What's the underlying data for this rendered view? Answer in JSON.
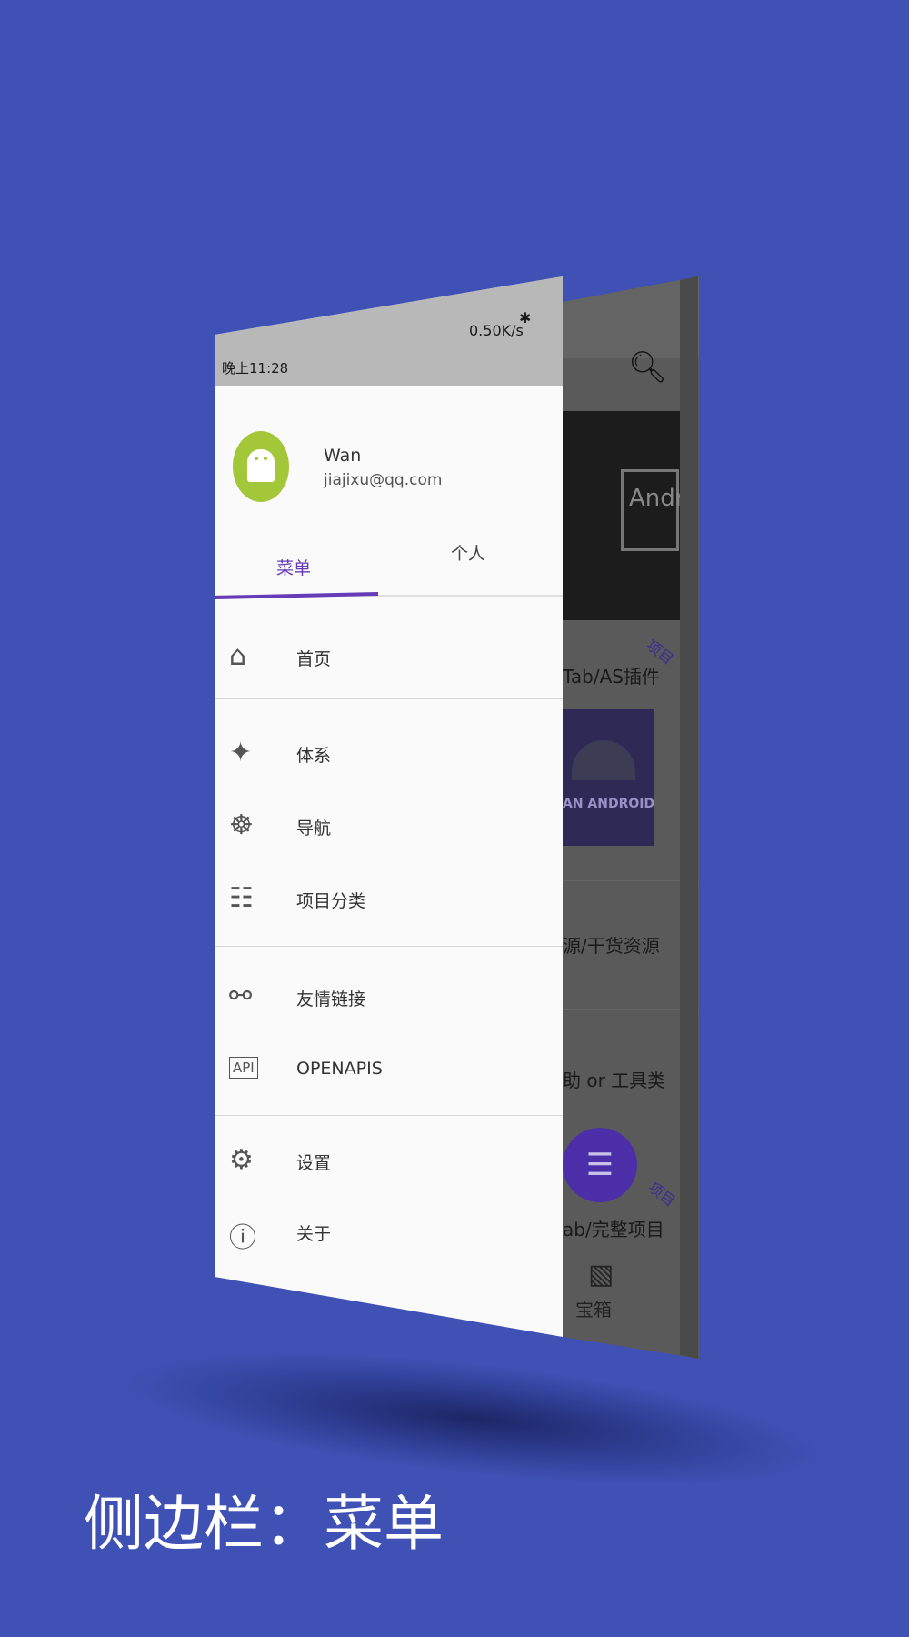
{
  "status_bar": {
    "time": "晚上11:28",
    "speed": "0.50K/s",
    "icons": [
      "bluetooth-icon",
      "alarm-icon",
      "signal-icon",
      "signal-icon",
      "wifi-icon",
      "battery-icon"
    ]
  },
  "user": {
    "name": "Wan",
    "email": "jiajixu@qq.com",
    "avatar_icon": "android-icon"
  },
  "tabs": [
    {
      "label": "菜单",
      "active": true
    },
    {
      "label": "个人",
      "active": false
    }
  ],
  "menu": {
    "items": [
      {
        "label": "首页",
        "icon": "home-icon"
      },
      {
        "label": "体系",
        "icon": "network-icon"
      },
      {
        "label": "导航",
        "icon": "ship-wheel-icon"
      },
      {
        "label": "项目分类",
        "icon": "hierarchy-icon"
      },
      {
        "label": "友情链接",
        "icon": "link-icon"
      },
      {
        "label": "OPENAPIS",
        "icon": "api-icon"
      },
      {
        "label": "设置",
        "icon": "settings-icon"
      },
      {
        "label": "关于",
        "icon": "info-icon"
      }
    ]
  },
  "background_app": {
    "search_icon": "search-icon",
    "thumb1_text": "Andr",
    "thumb2_text": "AN ANDROID",
    "tag": "项目",
    "line1": "Tab/AS插件",
    "line2": "源/干货资源",
    "line3": "助 or 工具类",
    "line4": "ab/完整项目",
    "fab_icon": "checklist-icon",
    "nav_icon": "gift-box-icon",
    "nav_label": "宝箱"
  },
  "caption": "侧边栏：菜单",
  "colors": {
    "page_background": "#3f51b5",
    "accent": "#673ab7",
    "avatar_background": "#a4c639",
    "drawer_background": "#fafafa"
  }
}
